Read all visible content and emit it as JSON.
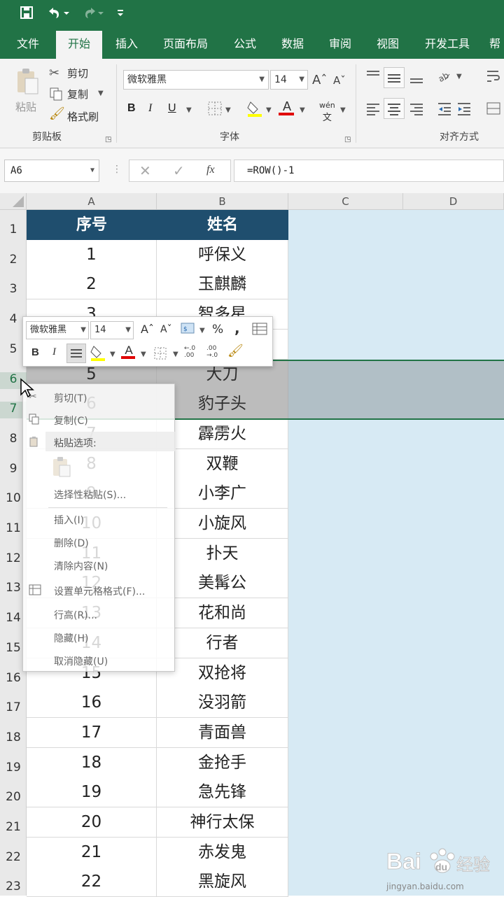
{
  "titlebar": {
    "save_icon": "save-icon",
    "undo_icon": "undo-icon",
    "redo_icon": "redo-icon",
    "customize_icon": "customize-qat-icon"
  },
  "tabs": [
    "文件",
    "开始",
    "插入",
    "页面布局",
    "公式",
    "数据",
    "审阅",
    "视图",
    "开发工具",
    "帮"
  ],
  "active_tab": "开始",
  "ribbon": {
    "clipboard": {
      "paste": "粘贴",
      "cut": "剪切",
      "copy": "复制",
      "format_painter": "格式刷",
      "label": "剪贴板"
    },
    "font": {
      "name": "微软雅黑",
      "size": "14",
      "bold": "B",
      "italic": "I",
      "underline": "U",
      "font_color_glyph": "A",
      "phonetic": "wén",
      "label": "字体"
    },
    "alignment": {
      "label": "对齐方式"
    }
  },
  "formula_bar": {
    "name_box": "A6",
    "fx": "fx",
    "formula": "=ROW()-1"
  },
  "columns": [
    "A",
    "B",
    "C",
    "D"
  ],
  "rows": [
    "1",
    "2",
    "3",
    "4",
    "5",
    "6",
    "7",
    "8",
    "9",
    "10",
    "11",
    "12",
    "13",
    "14",
    "15",
    "16",
    "17",
    "18",
    "19",
    "20",
    "21",
    "22",
    "23"
  ],
  "table": {
    "headers": [
      "序号",
      "姓名"
    ],
    "rows": [
      [
        "1",
        "呼保义"
      ],
      [
        "2",
        "玉麒麟"
      ],
      [
        "3",
        "智多星"
      ],
      [
        "4",
        ""
      ],
      [
        "5",
        "大刀"
      ],
      [
        "6",
        "豹子头"
      ],
      [
        "7",
        "霹雳火"
      ],
      [
        "8",
        "双鞭"
      ],
      [
        "9",
        "小李广"
      ],
      [
        "10",
        "小旋风"
      ],
      [
        "11",
        "扑天"
      ],
      [
        "12",
        "美髯公"
      ],
      [
        "13",
        "花和尚"
      ],
      [
        "14",
        "行者"
      ],
      [
        "15",
        "双抢将"
      ],
      [
        "16",
        "没羽箭"
      ],
      [
        "17",
        "青面兽"
      ],
      [
        "18",
        "金抢手"
      ],
      [
        "19",
        "急先锋"
      ],
      [
        "20",
        "神行太保"
      ],
      [
        "21",
        "赤发鬼"
      ],
      [
        "22",
        "黑旋风"
      ]
    ]
  },
  "mini_toolbar": {
    "font": "微软雅黑",
    "size": "14",
    "bold": "B",
    "italic": "I",
    "font_color": "A",
    "percent": "%",
    "comma": ",",
    "dec_inc": "←.0\n.00",
    "dec_dec": ".00\n→.0"
  },
  "context_menu": {
    "items": [
      "剪切(T)",
      "复制(C)",
      "粘贴选项:",
      "选择性粘贴(S)...",
      "插入(I)",
      "删除(D)",
      "清除内容(N)",
      "设置单元格格式(F)...",
      "行高(R)...",
      "隐藏(H)",
      "取消隐藏(U)"
    ]
  },
  "watermark": {
    "brand": "Bai",
    "brand2": "du",
    "tail": "经验",
    "url": "jingyan.baidu.com"
  },
  "colors": {
    "excel_green": "#217346",
    "header_fill": "#1f4e6e",
    "sheet_fill": "#d7eaf4"
  }
}
